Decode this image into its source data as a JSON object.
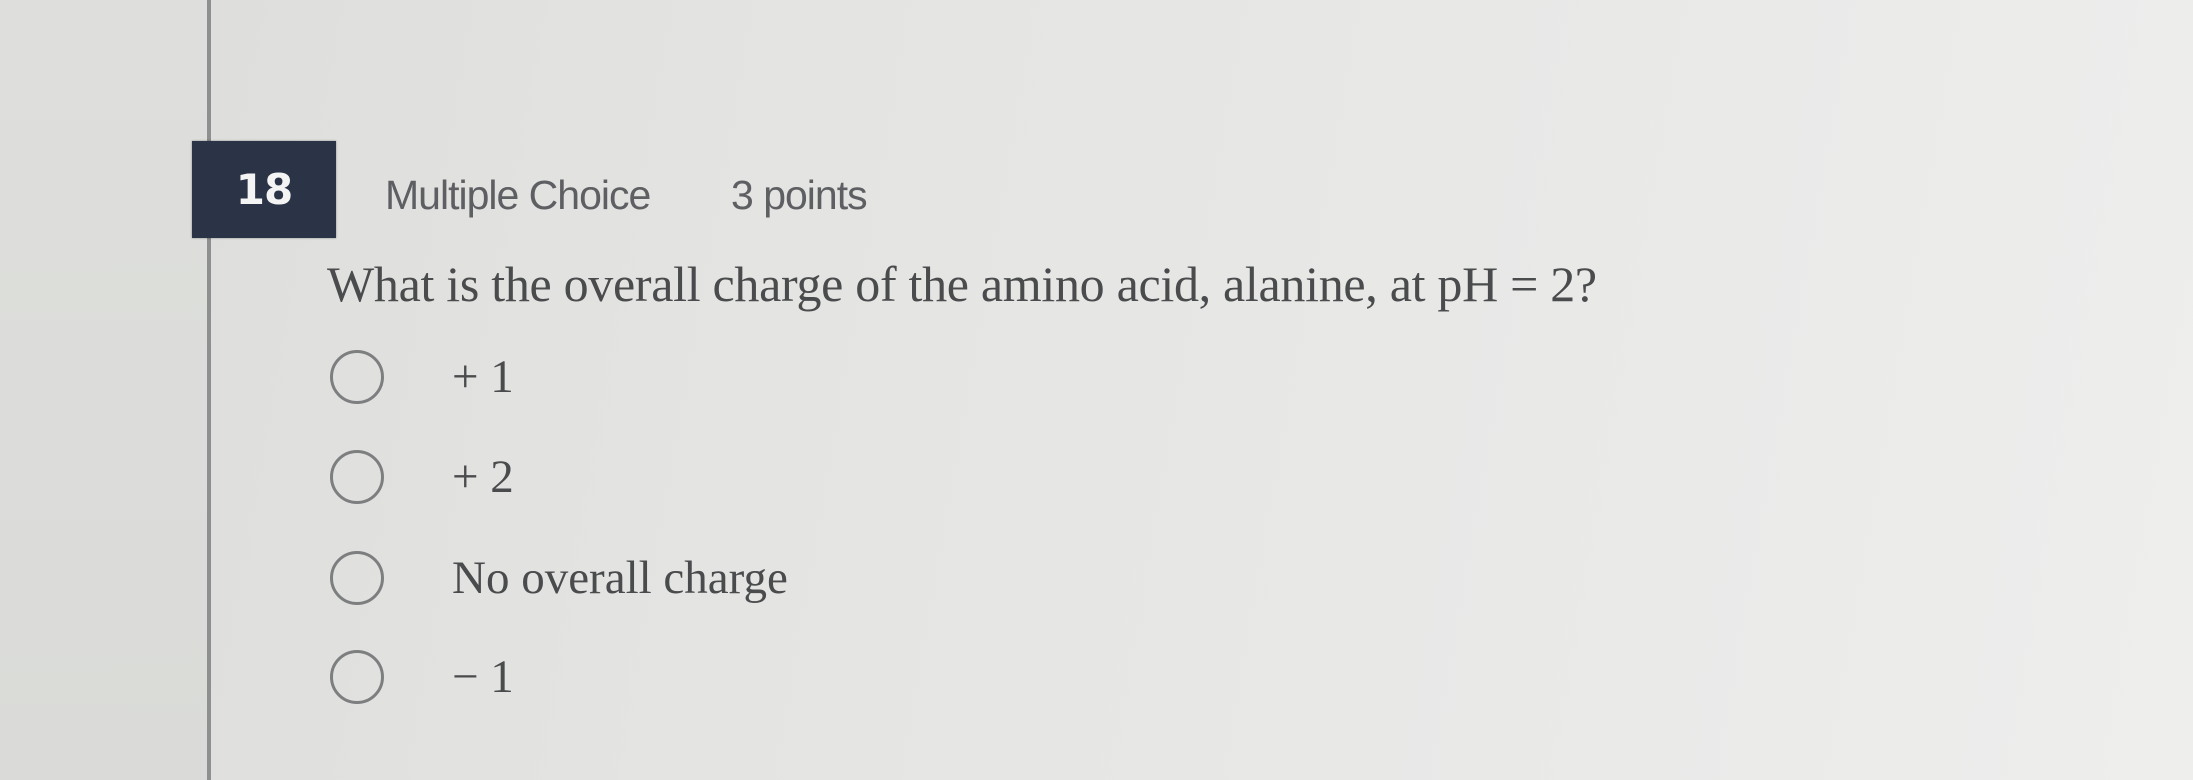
{
  "question": {
    "number": "18",
    "type": "Multiple Choice",
    "points": "3 points",
    "text": "What is the overall charge of the amino acid, alanine, at pH = 2?",
    "options": [
      {
        "label": "+ 1",
        "selected": false
      },
      {
        "label": "+ 2",
        "selected": false
      },
      {
        "label": "No overall charge",
        "selected": false
      },
      {
        "label": "− 1",
        "selected": false
      }
    ]
  },
  "colors": {
    "badge_background": "#2b3446",
    "badge_text": "#f4f4f4",
    "header_text": "#5d5f62",
    "body_text": "#4a4b4d",
    "radio_border": "#7d7e80"
  }
}
